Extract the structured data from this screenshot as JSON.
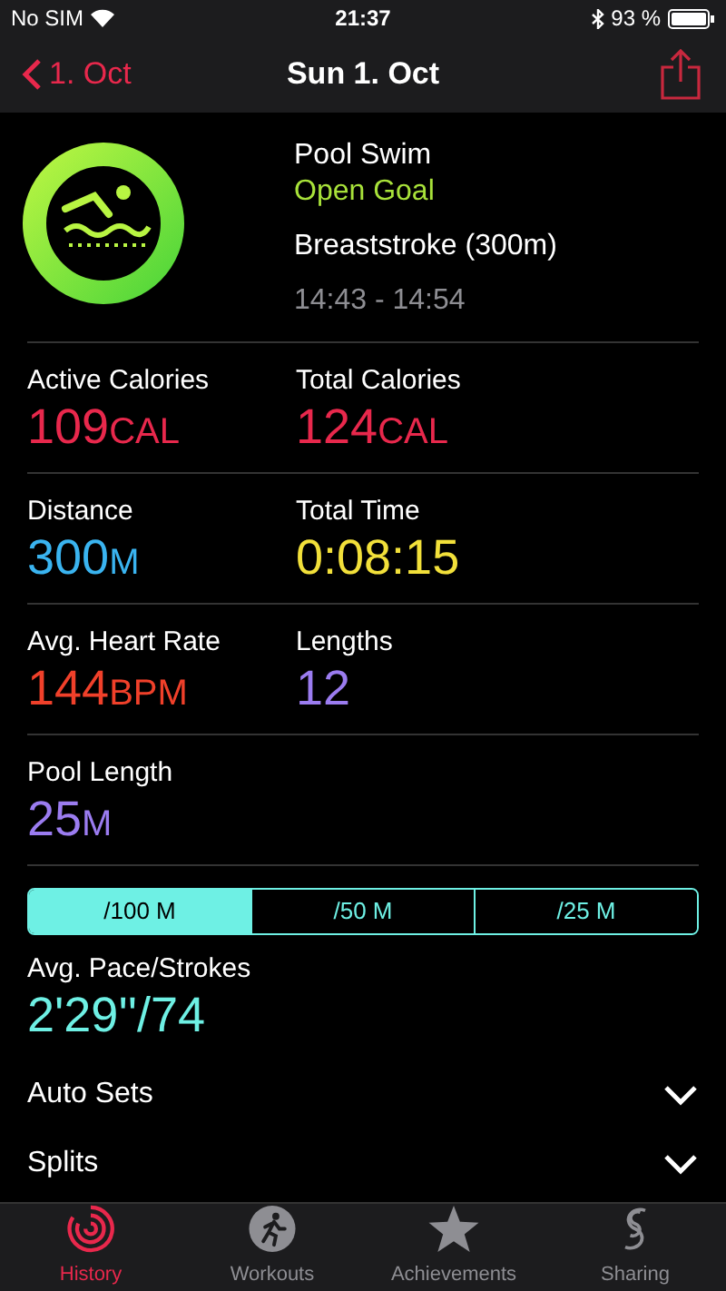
{
  "status_bar": {
    "carrier": "No SIM",
    "time": "21:37",
    "battery": "93 %"
  },
  "nav": {
    "back": "1. Oct",
    "title": "Sun 1. Oct"
  },
  "workout": {
    "type": "Pool Swim",
    "goal": "Open Goal",
    "stroke": "Breaststroke (300m)",
    "time_range": "14:43 - 14:54"
  },
  "metrics": [
    {
      "label": "Active Calories",
      "value": "109",
      "unit": "CAL",
      "color": "#e8284c"
    },
    {
      "label": "Total Calories",
      "value": "124",
      "unit": "CAL",
      "color": "#e8284c"
    },
    {
      "label": "Distance",
      "value": "300",
      "unit": "M",
      "color": "#3ab4f0"
    },
    {
      "label": "Total Time",
      "value": "0:08:15",
      "color": "#f2e03a"
    },
    {
      "label": "Avg. Heart Rate",
      "value": "144",
      "unit": "BPM",
      "color": "#f0402a"
    },
    {
      "label": "Lengths",
      "value": "12",
      "color": "#9b7cf0"
    },
    {
      "label": "Pool Length",
      "value": "25",
      "unit": "M",
      "color": "#9b7cf0"
    }
  ],
  "segments": [
    {
      "label": "/100 M",
      "selected": true
    },
    {
      "label": "/50 M",
      "selected": false
    },
    {
      "label": "/25 M",
      "selected": false
    }
  ],
  "pace": {
    "label": "Avg. Pace/Strokes",
    "value": "2'29''/74"
  },
  "sections": [
    {
      "label": "Auto Sets",
      "expanded": false
    },
    {
      "label": "Splits",
      "expanded": false
    }
  ],
  "tabs": [
    {
      "label": "History",
      "selected": true,
      "kind": "history"
    },
    {
      "label": "Workouts",
      "selected": false,
      "kind": "workouts"
    },
    {
      "label": "Achievements",
      "selected": false,
      "kind": "achievements"
    },
    {
      "label": "Sharing",
      "selected": false,
      "kind": "sharing"
    }
  ]
}
